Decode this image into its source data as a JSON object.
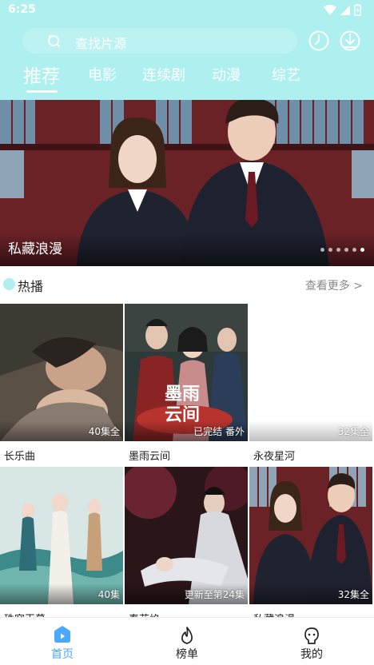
{
  "status_bar": {
    "time": "6:25"
  },
  "search": {
    "placeholder": "查找片源"
  },
  "tabs": [
    {
      "label": "推荐",
      "active": true
    },
    {
      "label": "电影",
      "active": false
    },
    {
      "label": "连续剧",
      "active": false
    },
    {
      "label": "动漫",
      "active": false
    },
    {
      "label": "综艺",
      "active": false
    }
  ],
  "banner": {
    "title": "私藏浪漫",
    "page_count": 6,
    "current_page": 6
  },
  "section": {
    "title": "热播",
    "more": "查看更多 >"
  },
  "items": [
    {
      "title": "长乐曲",
      "badge": "40集全"
    },
    {
      "title": "墨雨云间",
      "badge": "已完结 番外",
      "poster_text": "墨雨\n云间"
    },
    {
      "title": "永夜星河",
      "badge": "32集全"
    },
    {
      "title": "珠帘玉幕",
      "badge": "40集"
    },
    {
      "title": "春花焰",
      "badge": "更新至第24集"
    },
    {
      "title": "私藏浪漫",
      "badge": "32集全"
    }
  ],
  "bottom_nav": [
    {
      "label": "首页",
      "icon": "home-play-icon",
      "active": true
    },
    {
      "label": "榜单",
      "icon": "flame-icon",
      "active": false
    },
    {
      "label": "我的",
      "icon": "user-face-icon",
      "active": false
    }
  ],
  "colors": {
    "header": "#aef0f0",
    "accent": "#4aa8ff"
  }
}
